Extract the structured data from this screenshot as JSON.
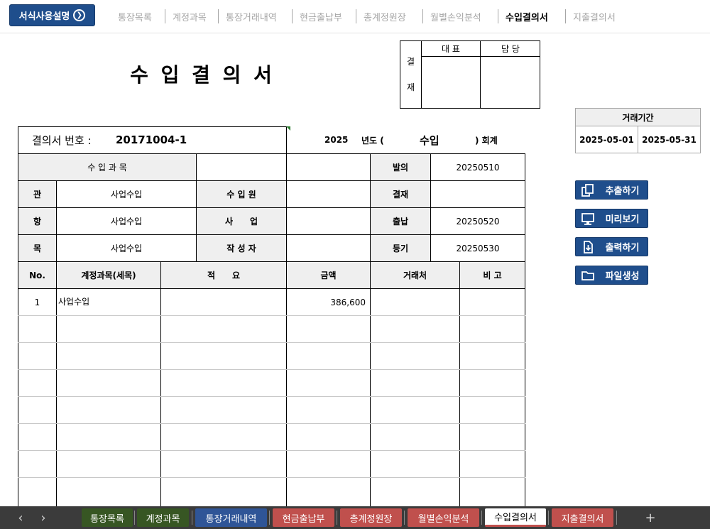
{
  "help_button": "서식사용설명",
  "top_nav": [
    "통장목록",
    "계정과목",
    "통장거래내역",
    "현금출납부",
    "총계정원장",
    "월별손익분석",
    "수입결의서",
    "지출결의서"
  ],
  "doc_title": "수 입 결 의 서",
  "approval": {
    "side_top": "결",
    "side_bottom": "재",
    "col1": "대 표",
    "col2": "담 당"
  },
  "period": {
    "label": "거래기간",
    "start": "2025-05-01",
    "end": "2025-05-31"
  },
  "header": {
    "number_label": "결의서 번호 :",
    "number_value": "20171004-1",
    "year": "2025",
    "year_label": "년도 (",
    "type": "수입",
    "type_suffix": ") 회계"
  },
  "form": {
    "subject_label": "수 입 과 목",
    "rows": [
      {
        "label": "관",
        "value": "사업수입",
        "label2": "수 입 원",
        "value2": ""
      },
      {
        "label": "항",
        "value": "사업수입",
        "label2": "사　　업",
        "value2": ""
      },
      {
        "label": "목",
        "value": "사업수입",
        "label2": "작 성 자",
        "value2": ""
      }
    ],
    "dates": [
      {
        "label": "발의",
        "value": "20250510"
      },
      {
        "label": "결재",
        "value": ""
      },
      {
        "label": "출납",
        "value": "20250520"
      },
      {
        "label": "등기",
        "value": "20250530"
      }
    ]
  },
  "table": {
    "headers": [
      "No.",
      "계정과목(세목)",
      "적　　요",
      "금액",
      "거래처",
      "비 고"
    ],
    "rows": [
      {
        "no": "1",
        "account": "사업수입",
        "desc": "",
        "amount": "386,600",
        "vendor": "",
        "note": ""
      }
    ]
  },
  "side_buttons": [
    "추출하기",
    "미리보기",
    "출력하기",
    "파일생성"
  ],
  "bottom_tabs": [
    {
      "label": "통장목록",
      "color": "#375623"
    },
    {
      "label": "계정과목",
      "color": "#375623"
    },
    {
      "label": "통장거래내역",
      "color": "#2f5597"
    },
    {
      "label": "현금출납부",
      "color": "#c0504d"
    },
    {
      "label": "총계정원장",
      "color": "#c0504d"
    },
    {
      "label": "월별손익분석",
      "color": "#c0504d"
    },
    {
      "label": "수입결의서",
      "color": "#ffffff"
    },
    {
      "label": "지출결의서",
      "color": "#c0504d"
    }
  ],
  "tab_nav": {
    "prev": "‹",
    "next": "›",
    "add": "+"
  }
}
